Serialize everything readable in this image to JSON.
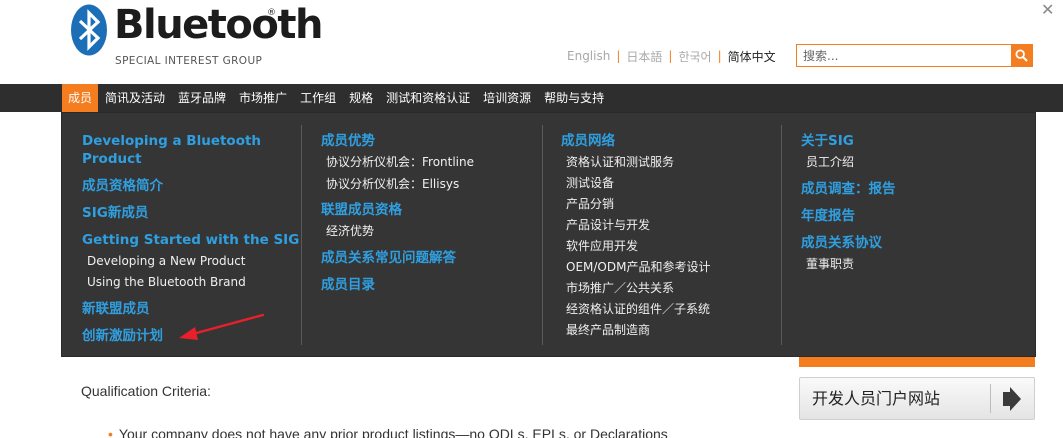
{
  "logo": {
    "wordmark": "Bluetooth",
    "registered": "®",
    "tagline": "SPECIAL INTEREST GROUP"
  },
  "window": {
    "close_glyph": "✕"
  },
  "languages": [
    {
      "label": "English",
      "active": false
    },
    {
      "label": "日本語",
      "active": false
    },
    {
      "label": "한국어",
      "active": false
    },
    {
      "label": "简体中文",
      "active": true
    }
  ],
  "search": {
    "placeholder": "搜索...",
    "value": ""
  },
  "nav": {
    "items": [
      "成员",
      "简讯及活动",
      "蓝牙品牌",
      "市场推广",
      "工作组",
      "规格",
      "测试和资格认证",
      "培训资源",
      "帮助与支持"
    ],
    "active_index": 0
  },
  "dropdown": {
    "col1": {
      "links": [
        "Developing a Bluetooth",
        "Product",
        "成员资格简介",
        "SIG新成员",
        "Getting Started with the SIG",
        "新联盟成员",
        "创新激励计划"
      ],
      "sublinks": [
        "Developing a New Product",
        "Using the Bluetooth Brand"
      ]
    },
    "col2": {
      "links": [
        "成员优势",
        "联盟成员资格",
        "成员关系常见问题解答",
        "成员目录"
      ],
      "sublinks": [
        "协议分析仪机会：Frontline",
        "协议分析仪机会：Ellisys",
        "经济优势"
      ]
    },
    "col3": {
      "links": [
        "成员网络"
      ],
      "sublinks": [
        "资格认证和测试服务",
        "测试设备",
        "产品分销",
        "产品设计与开发",
        "软件应用开发",
        "OEM/ODM产品和参考设计",
        "市场推广／公共关系",
        "经资格认证的组件／子系统",
        "最终产品制造商"
      ]
    },
    "col4": {
      "links": [
        "关于SIG",
        "成员调查：报告",
        "年度报告",
        "成员关系协议"
      ],
      "sublinks": [
        "员工介绍",
        "董事职责"
      ]
    }
  },
  "page": {
    "qualification_label": "Qualification Criteria:",
    "bullet_text": "Your company does not have any prior product listings—no QDLs, EPLs, or Declarations",
    "dev_portal_button": "开发人员门户网站"
  },
  "colors": {
    "accent": "#f47d20",
    "link_blue": "#2f9fe0",
    "nav_bg": "#2e2e2e",
    "dropdown_bg": "#353535",
    "annotation_red": "#e8202a"
  }
}
